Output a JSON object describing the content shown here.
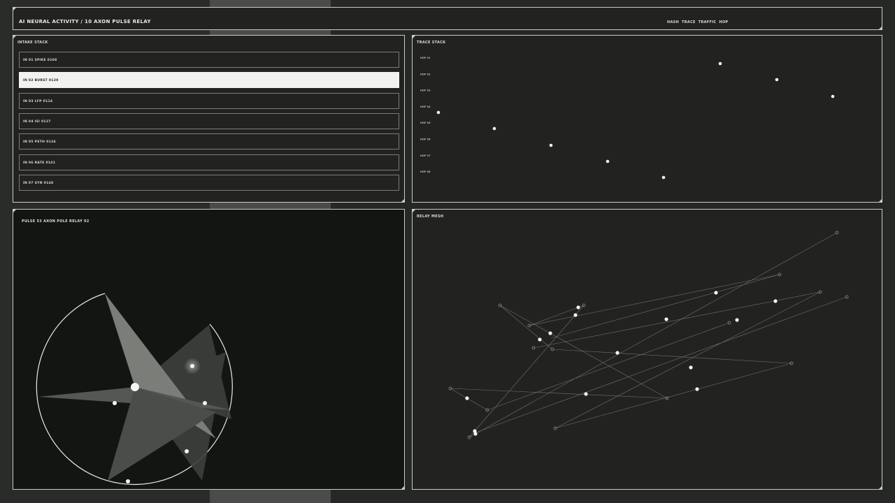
{
  "header": {
    "title": "AI NEURAL ACTIVITY / 10 AXON PULSE RELAY",
    "links": [
      "HASH",
      "TRACE",
      "TRAFFIC",
      "HOP"
    ]
  },
  "intake": {
    "title": "INTAKE STACK",
    "rows": [
      {
        "label": "IN 01  SPIKE  0108",
        "active": false
      },
      {
        "label": "IN 02  BURST  0120",
        "active": true
      },
      {
        "label": "IN 03  LFP  0114",
        "active": false
      },
      {
        "label": "IN 04  ISI  0127",
        "active": false
      },
      {
        "label": "IN 05  PSTH  0134",
        "active": false
      },
      {
        "label": "IN 06  RATE  0141",
        "active": false
      },
      {
        "label": "IN 07  SYN  0148",
        "active": false
      }
    ]
  },
  "trace": {
    "title": "TRACE STACK",
    "row_labels": [
      "HOP 01",
      "HOP 02",
      "HOP 03",
      "HOP 04",
      "HOP 05",
      "HOP 06",
      "HOP 07",
      "HOP 08"
    ]
  },
  "pulse": {
    "title": "PULSE 53  AXON POLE  RELAY 02"
  },
  "mesh": {
    "title": "RELAY MESH"
  },
  "colors": {
    "panel": "#222321",
    "border": "#c9ccc7",
    "dot": "#f4f5f2",
    "active_row": "#f1f3ef"
  }
}
